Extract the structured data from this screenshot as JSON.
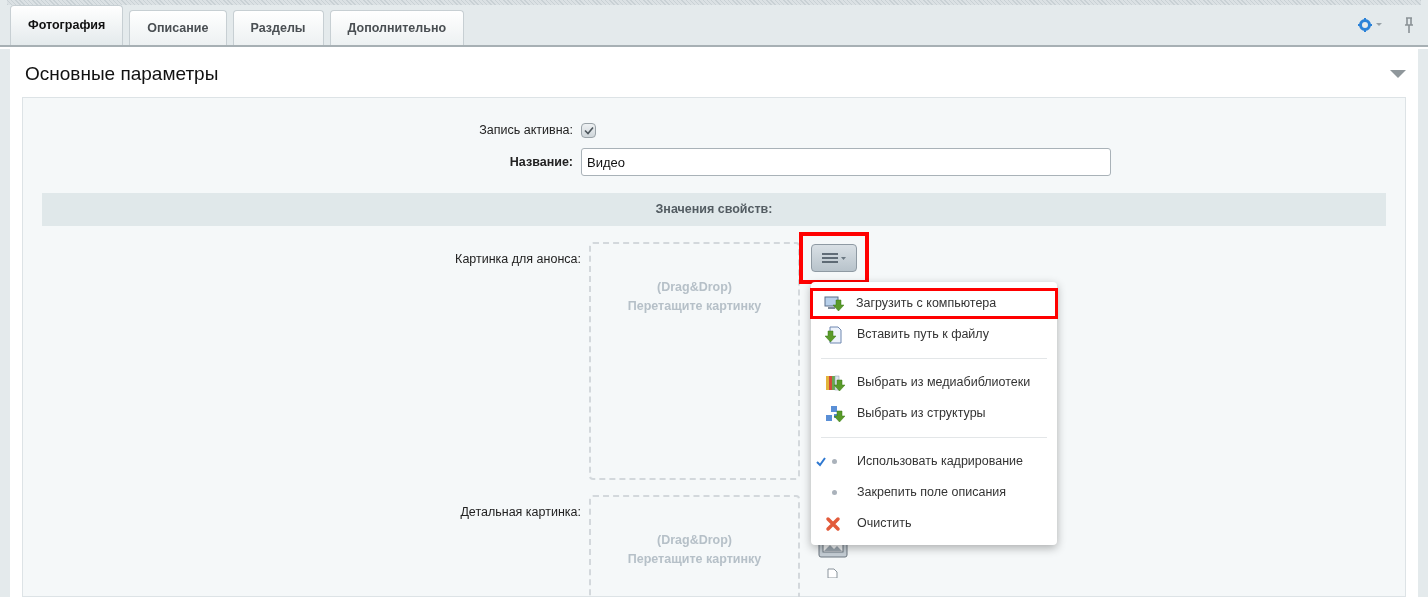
{
  "tabs": [
    {
      "label": "Фотография",
      "selected": true
    },
    {
      "label": "Описание",
      "selected": false
    },
    {
      "label": "Разделы",
      "selected": false
    },
    {
      "label": "Дополнительно",
      "selected": false
    }
  ],
  "panel": {
    "title": "Основные параметры",
    "expanded": true
  },
  "fields": {
    "active": {
      "label": "Запись активна:",
      "checked": true
    },
    "name": {
      "label": "Название:",
      "value": "Видео"
    }
  },
  "section": {
    "title": "Значения свойств:"
  },
  "images": [
    {
      "label": "Картинка для анонса:",
      "drop_hint": "(Drag&Drop)",
      "drop_text": "Перетащите картинку",
      "menu_button": {
        "highlighted": true
      }
    },
    {
      "label": "Детальная картинка:",
      "drop_hint": "(Drag&Drop)",
      "drop_text": "Перетащите картинку"
    }
  ],
  "menu": {
    "items": [
      {
        "kind": "upload",
        "label": "Загрузить с компьютера",
        "highlighted": true
      },
      {
        "kind": "path",
        "label": "Вставить путь к файлу",
        "highlighted": false
      },
      {
        "kind": "separator"
      },
      {
        "kind": "medialib",
        "label": "Выбрать из медиабиблиотеки",
        "highlighted": false
      },
      {
        "kind": "structure",
        "label": "Выбрать из структуры",
        "highlighted": false
      },
      {
        "kind": "separator"
      },
      {
        "kind": "option",
        "label": "Использовать кадрирование",
        "checked": true
      },
      {
        "kind": "option",
        "label": "Закрепить поле описания",
        "checked": false
      },
      {
        "kind": "clear",
        "label": "Очистить",
        "highlighted": false
      }
    ]
  }
}
